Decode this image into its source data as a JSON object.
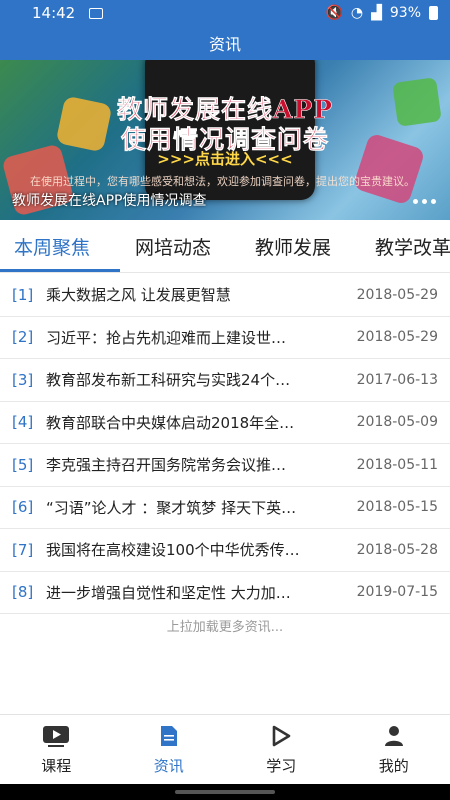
{
  "status_bar": {
    "time": "14:42",
    "battery": "93%"
  },
  "app_title": "资讯",
  "banner": {
    "headline_line1": "教师发展在线APP",
    "headline_line2": "使用情况调查问卷",
    "headline_line3": ">>>点击进入<<<",
    "headline_line4": "在使用过程中，您有哪些感受和想法，欢迎参加调查问卷，提出您的宝贵建议。",
    "caption": "教师发展在线APP使用情况调查"
  },
  "tabs": [
    "本周聚焦",
    "网培动态",
    "教师发展",
    "教学改革"
  ],
  "news": [
    {
      "index": "[1]",
      "title": "乘大数据之风 让发展更智慧",
      "date": "2018-05-29"
    },
    {
      "index": "[2]",
      "title": "习近平：抢占先机迎难而上建设世…",
      "date": "2018-05-29"
    },
    {
      "index": "[3]",
      "title": "教育部发布新工科研究与实践24个…",
      "date": "2017-06-13"
    },
    {
      "index": "[4]",
      "title": "教育部联合中央媒体启动2018年全…",
      "date": "2018-05-09"
    },
    {
      "index": "[5]",
      "title": "李克强主持召开国务院常务会议推…",
      "date": "2018-05-11"
    },
    {
      "index": "[6]",
      "title": "“习语”论人才 ：聚才筑梦 择天下英…",
      "date": "2018-05-15"
    },
    {
      "index": "[7]",
      "title": "我国将在高校建设100个中华优秀传…",
      "date": "2018-05-28"
    },
    {
      "index": "[8]",
      "title": "进一步增强自觉性和坚定性 大力加…",
      "date": "2019-07-15"
    }
  ],
  "load_more": "上拉加载更多资讯...",
  "bottom_nav": [
    {
      "label": "课程",
      "icon": "video-icon"
    },
    {
      "label": "资讯",
      "icon": "document-icon"
    },
    {
      "label": "学习",
      "icon": "play-icon"
    },
    {
      "label": "我的",
      "icon": "person-icon"
    }
  ],
  "colors": {
    "primary": "#2f74c7",
    "text": "#222222",
    "date": "#666666"
  }
}
